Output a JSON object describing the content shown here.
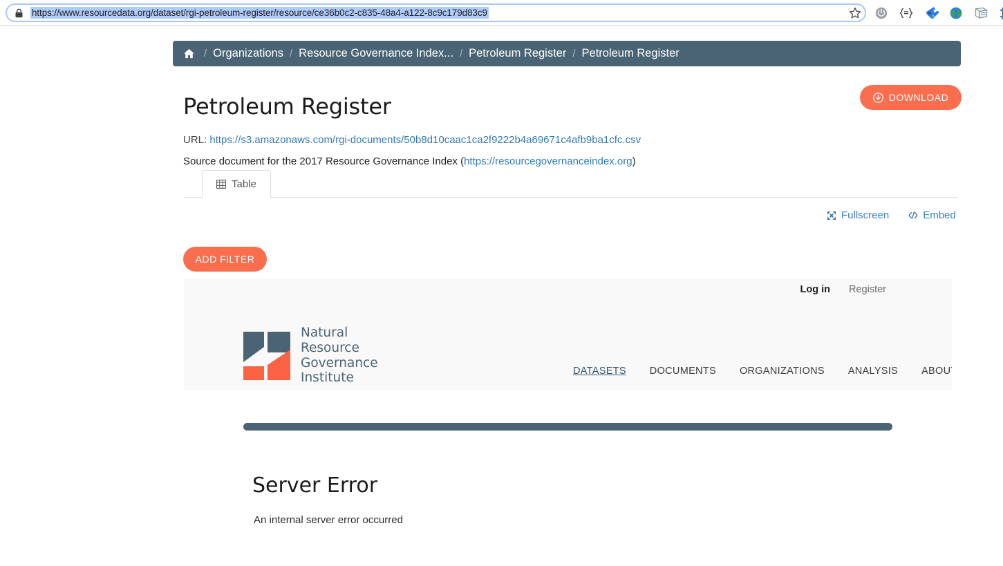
{
  "browser": {
    "url": "https://www.resourcedata.org/dataset/rgi-petroleum-register/resource/ce36b0c2-c835-48a4-a122-8c9c179d83c9",
    "lock_icon": "lock-icon",
    "bookmark_icon": "star-outline-icon",
    "extensions": [
      {
        "name": "power-circle-icon",
        "glyph": "⏻"
      },
      {
        "name": "braces-menu-icon",
        "glyph": "{≡}"
      },
      {
        "name": "puzzle-blue-icon",
        "glyph": ""
      },
      {
        "name": "globe-icon",
        "glyph": ""
      },
      {
        "name": "notebook-icon",
        "glyph": ""
      },
      {
        "name": "crop-frame-icon",
        "glyph": ""
      }
    ]
  },
  "breadcrumb": {
    "home_icon": "home-icon",
    "items": [
      {
        "label": "Organizations"
      },
      {
        "label": "Resource Governance Index..."
      },
      {
        "label": "Petroleum Register"
      },
      {
        "label": "Petroleum Register"
      }
    ],
    "separator": "/",
    "bg_color": "#4a6375"
  },
  "resource": {
    "title": "Petroleum Register",
    "download_label": "DOWNLOAD",
    "download_icon": "download-circle-icon",
    "url_label": "URL:",
    "url_value": "https://s3.amazonaws.com/rgi-documents/50b8d10caac1ca2f9222b4a69671c4afb9ba1cfc.csv",
    "description_prefix": "Source document for the 2017 Resource Governance Index (",
    "description_link": "https://resourcegovernanceindex.org",
    "description_suffix": ")",
    "accent_color": "#fa6e50",
    "link_color": "#337ab7"
  },
  "tabs": [
    {
      "label": "Table",
      "icon": "table-grid-icon",
      "active": true
    }
  ],
  "view_controls": [
    {
      "label": "Fullscreen",
      "icon": "expand-arrows-icon"
    },
    {
      "label": "Embed",
      "icon": "code-brackets-icon"
    }
  ],
  "filter": {
    "add_filter_label": "ADD FILTER"
  },
  "embedded_site": {
    "user_links": [
      {
        "label": "Log in",
        "emphasis": true
      },
      {
        "label": "Register",
        "emphasis": false
      }
    ],
    "logo": {
      "name": "nrgi-logo",
      "lines": [
        "Natural",
        "Resource",
        "Governance",
        "Institute"
      ],
      "dark_color": "#4a6375",
      "accent_color": "#fa6e50"
    },
    "nav": [
      {
        "label": "DATASETS",
        "active": true
      },
      {
        "label": "DOCUMENTS",
        "active": false
      },
      {
        "label": "ORGANIZATIONS",
        "active": false
      },
      {
        "label": "ANALYSIS",
        "active": false
      },
      {
        "label": "ABOUT",
        "active": false
      }
    ],
    "divider_color": "#4a6375",
    "error": {
      "title": "Server Error",
      "message": "An internal server error occurred"
    }
  }
}
